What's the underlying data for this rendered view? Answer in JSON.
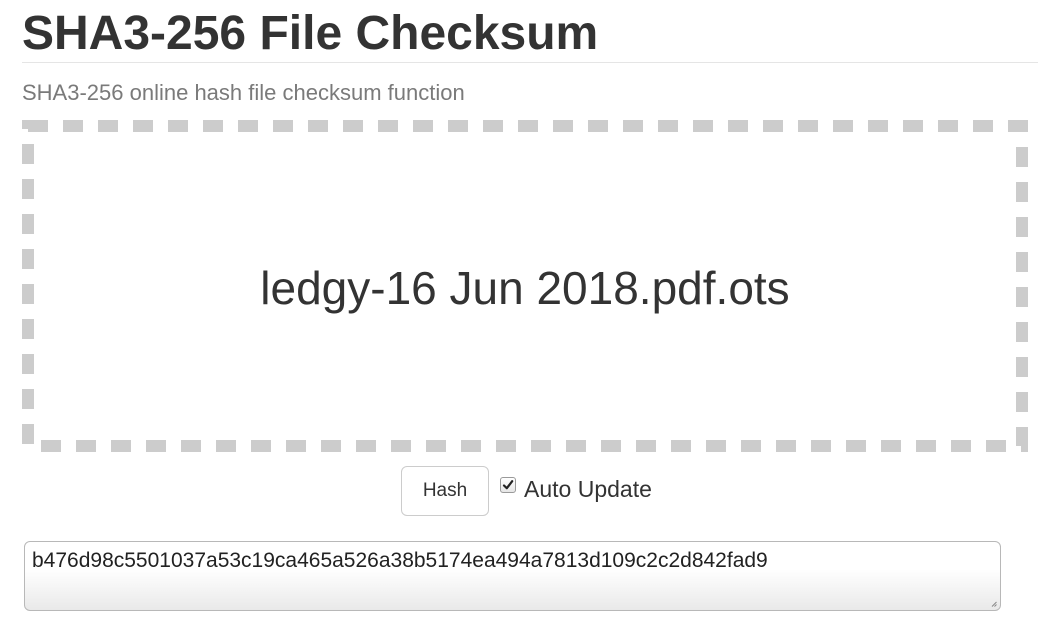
{
  "header": {
    "title": "SHA3-256 File Checksum",
    "subtitle": "SHA3-256 online hash file checksum function"
  },
  "dropzone": {
    "filename": "ledgy-16 Jun 2018.pdf.ots",
    "border_color": "#cccccc"
  },
  "controls": {
    "hash_button_label": "Hash",
    "auto_update_label": "Auto Update",
    "auto_update_checked": true
  },
  "output": {
    "value": "b476d98c5501037a53c19ca465a526a38b5174ea494a7813d109c2c2d842fad9"
  },
  "icons": {
    "checkbox_check": "checkmark-icon",
    "textarea_grip": "resize-grip-icon"
  }
}
